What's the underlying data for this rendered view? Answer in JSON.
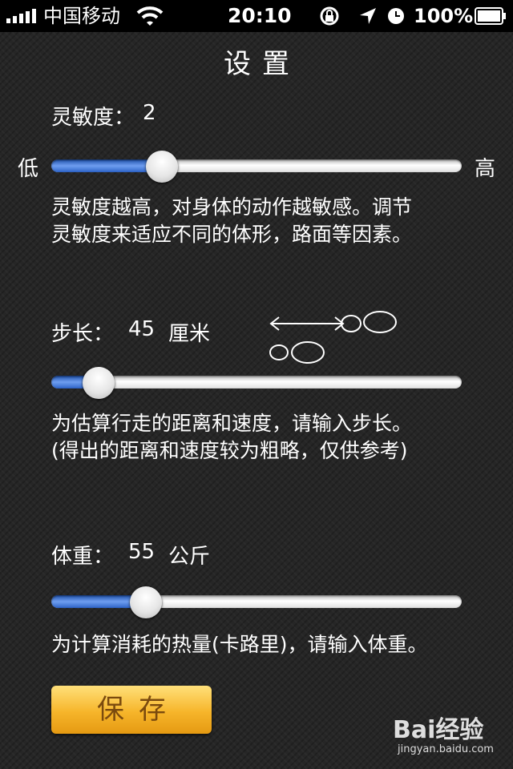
{
  "status_bar": {
    "carrier": "中国移动",
    "time": "20:10",
    "battery": "100%",
    "icons": [
      "signal-icon",
      "wifi-icon",
      "rotation-lock-icon",
      "location-icon",
      "alarm-icon",
      "battery-icon"
    ]
  },
  "title": "设置",
  "sensitivity": {
    "label": "灵敏度：",
    "value": "2",
    "low": "低",
    "high": "高",
    "level": 0.27,
    "description_line1": "灵敏度越高，对身体的动作越敏感。调节",
    "description_line2": "灵敏度来适应不同的体形，路面等因素。"
  },
  "stride": {
    "label": "步长：",
    "value": "45",
    "unit": "厘米",
    "level": 0.115,
    "description_line1": "为估算行走的距离和速度，请输入步长。",
    "description_line2": "(得出的距离和速度较为粗略，仅供参考)"
  },
  "weight": {
    "label": "体重：",
    "value": "55",
    "unit": "公斤",
    "level": 0.23,
    "description": "为计算消耗的热量(卡路里)，请输入体重。"
  },
  "save_label": "保存",
  "watermark": {
    "brand": "Bai经验",
    "url": "jingyan.baidu.com"
  },
  "colors": {
    "slider_fill": "#3f74d8",
    "save_button": "#f6b52a"
  }
}
